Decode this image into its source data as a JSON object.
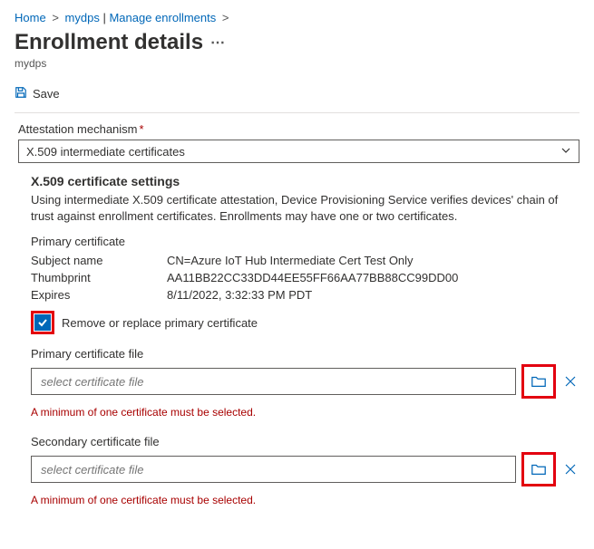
{
  "breadcrumb": {
    "home": "Home",
    "resource": "mydps",
    "page": "Manage enrollments"
  },
  "header": {
    "title": "Enrollment details",
    "subtitle": "mydps"
  },
  "toolbar": {
    "save_label": "Save"
  },
  "form": {
    "attestation_label": "Attestation mechanism",
    "attestation_value": "X.509 intermediate certificates",
    "settings_title": "X.509 certificate settings",
    "settings_desc": "Using intermediate X.509 certificate attestation, Device Provisioning Service verifies devices' chain of trust against enrollment certificates. Enrollments may have one or two certificates.",
    "primary_cert_label": "Primary certificate",
    "subject_name_label": "Subject name",
    "subject_name_value": "CN=Azure IoT Hub Intermediate Cert Test Only",
    "thumbprint_label": "Thumbprint",
    "thumbprint_value": "AA11BB22CC33DD44EE55FF66AA77BB88CC99DD00",
    "expires_label": "Expires",
    "expires_value": "8/11/2022, 3:32:33 PM PDT",
    "remove_label": "Remove or replace primary certificate",
    "primary_file_label": "Primary certificate file",
    "secondary_file_label": "Secondary certificate file",
    "file_placeholder": "select certificate file",
    "error_text": "A minimum of one certificate must be selected."
  }
}
